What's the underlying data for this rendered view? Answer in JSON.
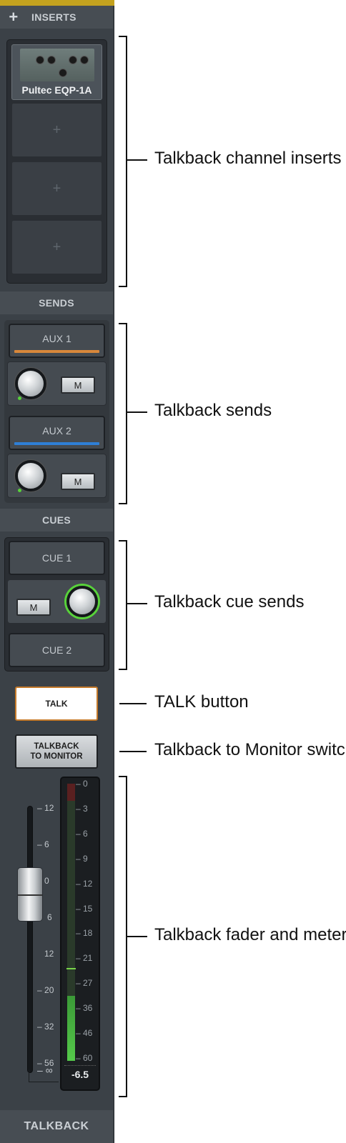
{
  "strip": {
    "inserts_label": "INSERTS",
    "add_icon": "plus-icon",
    "plugin_name": "Pultec EQP-1A",
    "empty_slot_glyph": "+",
    "sends_label": "SENDS",
    "aux1_label": "AUX 1",
    "aux2_label": "AUX 2",
    "mute_label": "M",
    "cues_label": "CUES",
    "cue1_label": "CUE 1",
    "cue2_label": "CUE 2",
    "talk_label": "TALK",
    "talkback_monitor_line1": "TALKBACK",
    "talkback_monitor_line2": "TO MONITOR",
    "fader_scale": [
      "12",
      "6",
      "0",
      "6",
      "12",
      "20",
      "32",
      "56",
      "∞"
    ],
    "meter_scale": [
      "0",
      "3",
      "6",
      "9",
      "12",
      "15",
      "18",
      "21",
      "27",
      "36",
      "46",
      "60"
    ],
    "meter_readout": "-6.5",
    "strip_name": "TALKBACK"
  },
  "colors": {
    "aux1_stripe": "#d8873b",
    "aux2_stripe": "#2f7fd6",
    "accent_top": "#c4a21e",
    "talk_border": "#c57a2a",
    "meter_green": "#55c94a"
  },
  "meter": {
    "fill_fraction": 0.235,
    "peak_fraction": 0.33
  },
  "callouts": {
    "inserts": "Talkback channel inserts",
    "sends": "Talkback sends",
    "cue_sends": "Talkback cue sends",
    "talk_button": "TALK button",
    "monitor_switch": "Talkback to Monitor switch",
    "fader_meter": "Talkback fader and meter"
  }
}
